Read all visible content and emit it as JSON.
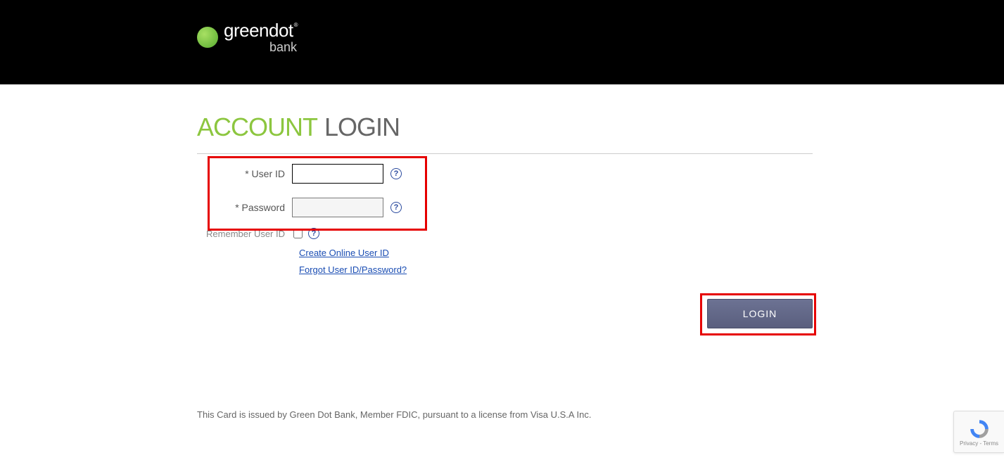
{
  "header": {
    "brand": "greendot",
    "brand_suffix": "®",
    "sub": "bank"
  },
  "page": {
    "title_part1": "ACCOUNT",
    "title_part2": "LOGIN"
  },
  "form": {
    "user_id_label": "* User ID",
    "user_id_value": "",
    "password_label": "* Password",
    "password_value": "",
    "remember_label": "Remember User ID",
    "remember_checked": false,
    "create_link": "Create Online User ID",
    "forgot_link": "Forgot User ID/Password?",
    "login_button": "LOGIN"
  },
  "footer": {
    "disclaimer": "This Card is issued by Green Dot Bank, Member FDIC, pursuant to a license from Visa U.S.A Inc."
  },
  "recaptcha": {
    "links": "Privacy - Terms"
  }
}
